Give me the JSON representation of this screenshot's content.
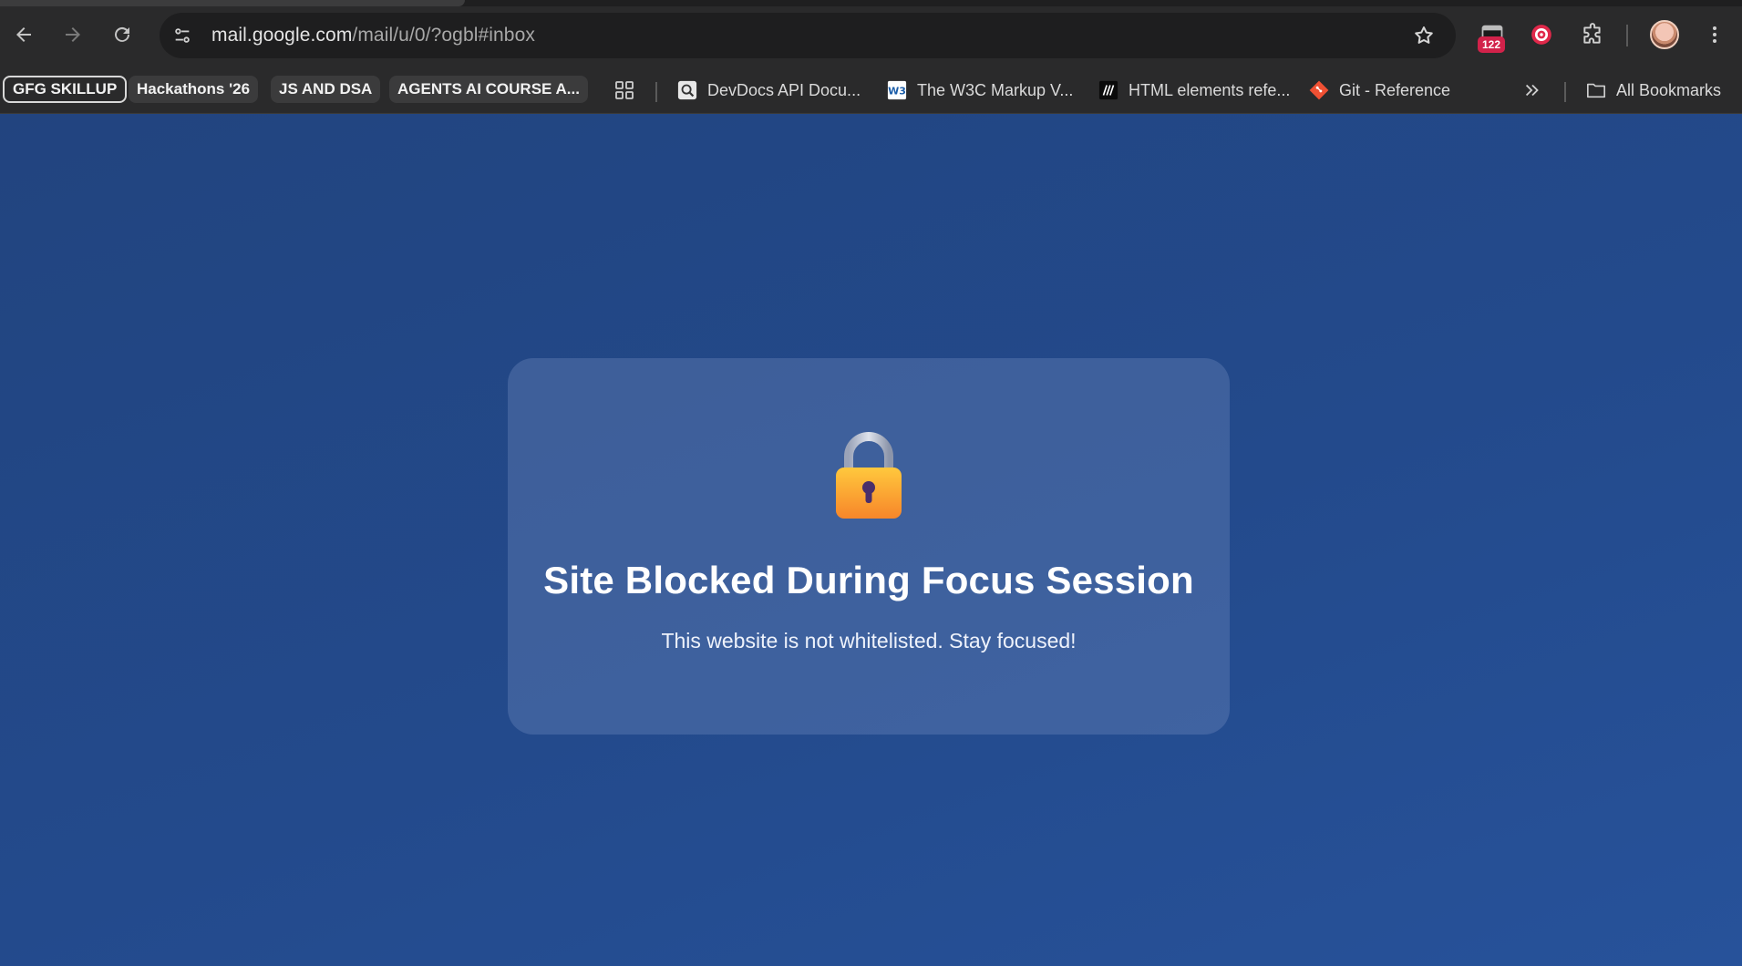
{
  "browser": {
    "url_host": "mail.google.com",
    "url_path": "/mail/u/0/?ogbl#inbox",
    "extension_badge": "122",
    "icons": [
      "back-arrow-icon",
      "forward-arrow-icon",
      "reload-icon",
      "site-info-icon",
      "star-icon",
      "calendar-extension-icon",
      "target-extension-icon",
      "puzzle-extensions-icon",
      "profile-avatar",
      "more-vert-icon"
    ]
  },
  "bookmarks": {
    "groups": [
      "GFG SKILLUP",
      "Hackathons '26",
      "JS AND DSA",
      "AGENTS AI COURSE A..."
    ],
    "items": [
      {
        "label": "DevDocs API Docu...",
        "icon": "devdocs-icon"
      },
      {
        "label": "The W3C Markup V...",
        "icon": "w3c-icon"
      },
      {
        "label": "HTML elements refe...",
        "icon": "mdn-icon"
      },
      {
        "label": "Git - Reference",
        "icon": "git-icon"
      }
    ],
    "all_bookmarks": "All Bookmarks",
    "colors": {
      "git": "#f05033",
      "w3c": "#1c5ea9"
    }
  },
  "blocked_page": {
    "icon": "lock-icon",
    "title": "Site Blocked During Focus Session",
    "message": "This website is not whitelisted. Stay focused!",
    "colors": {
      "background": "#234a8c",
      "lock_body": "#f7a531",
      "text": "#ffffff"
    }
  }
}
